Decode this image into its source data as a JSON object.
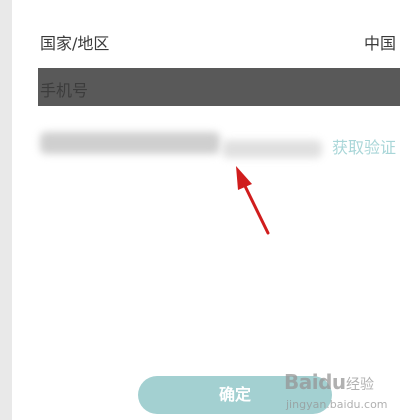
{
  "form": {
    "country_label": "国家/地区",
    "country_value": "中国",
    "phone_placeholder": "手机号",
    "get_code_label": "获取验证",
    "confirm_label": "确定"
  },
  "watermark": {
    "brand": "Baidu",
    "suffix": "经验",
    "url": "jingyan.baidu.com"
  },
  "colors": {
    "accent": "#a3d0d1",
    "link": "#a9d6d8",
    "phone_field_highlight": "#595959",
    "annotation_arrow": "#d01d1d"
  }
}
